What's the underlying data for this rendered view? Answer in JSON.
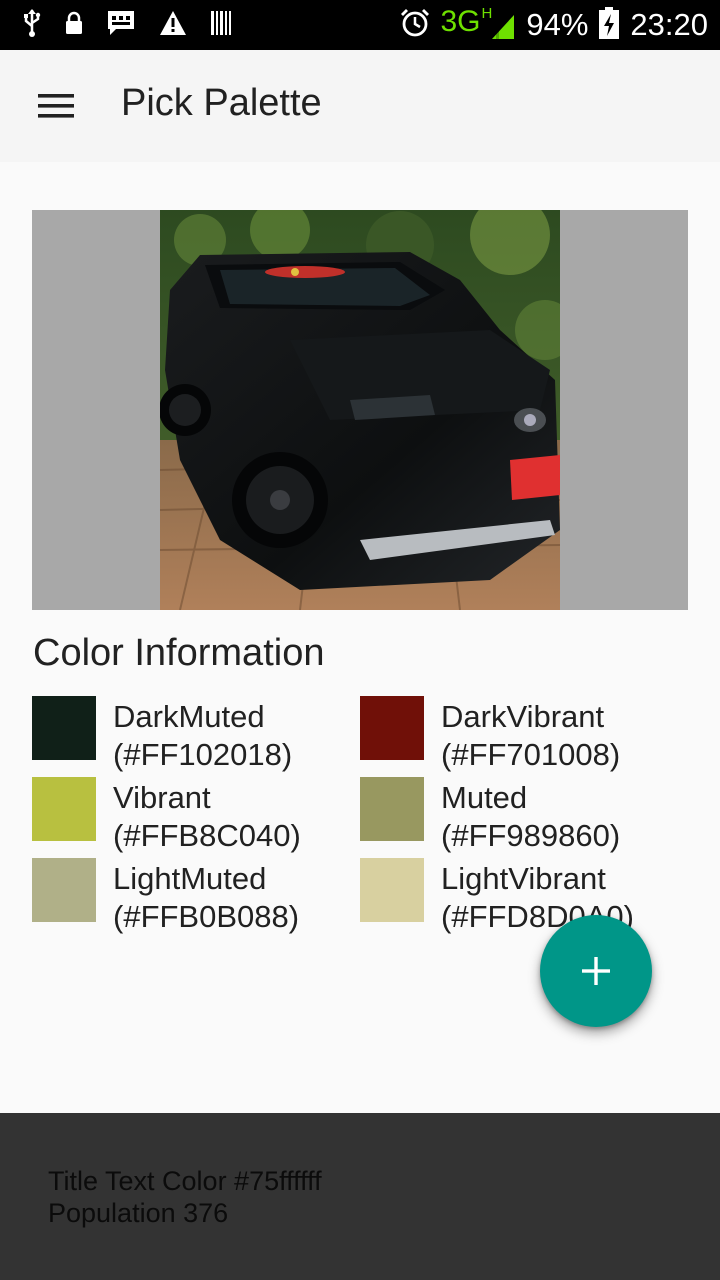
{
  "status_bar": {
    "icons_left": [
      "usb-icon",
      "lock-icon",
      "message-icon",
      "warning-icon",
      "barcode-icon"
    ],
    "alarm_icon": "alarm-icon",
    "network": "3G",
    "network_sub": "H",
    "battery": "94%",
    "time": "23:20"
  },
  "app_bar": {
    "menu_icon": "hamburger-menu-icon",
    "title": "Pick Palette"
  },
  "image": {
    "description_icon": "car-photo"
  },
  "color_info": {
    "title": "Color Information",
    "swatches": [
      {
        "name": "DarkMuted",
        "hex": "(#FF102018)",
        "color": "#102018"
      },
      {
        "name": "DarkVibrant",
        "hex": "(#FF701008)",
        "color": "#701008"
      },
      {
        "name": "Vibrant",
        "hex": "(#FFB8C040)",
        "color": "#B8C040"
      },
      {
        "name": "Muted",
        "hex": "(#FF989860)",
        "color": "#989860"
      },
      {
        "name": "LightMuted",
        "hex": "(#FFB0B088)",
        "color": "#B0B088"
      },
      {
        "name": "LightVibrant",
        "hex": "(#FFD8D0A0)",
        "color": "#D8D0A0"
      }
    ]
  },
  "fab": {
    "icon": "plus-icon",
    "color": "#009688"
  },
  "bottom_panel": {
    "title_text_color": "Title Text Color #75ffffff",
    "population": "Population 376"
  }
}
